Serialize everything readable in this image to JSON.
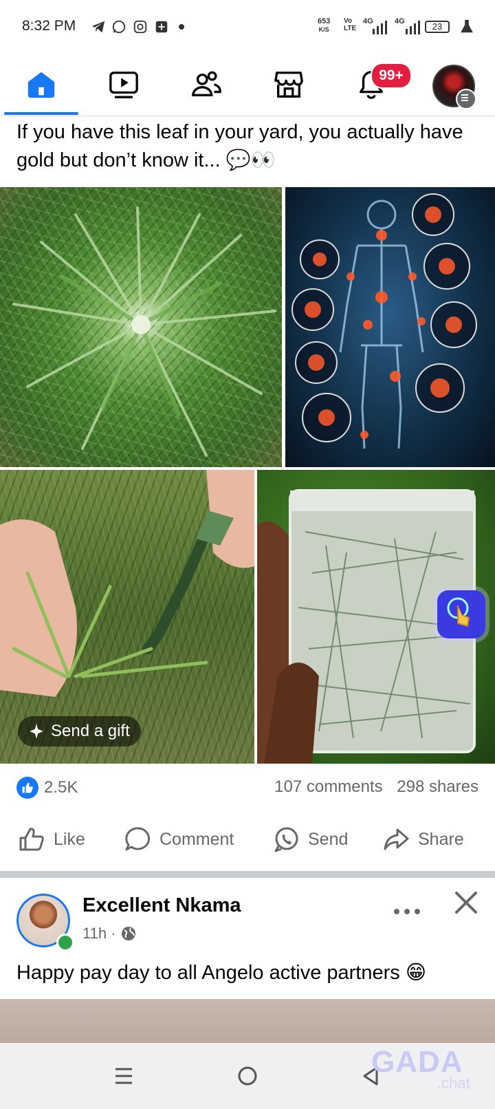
{
  "status_bar": {
    "time": "8:32 PM",
    "speed_value": "653",
    "speed_unit": "K/S",
    "net_label_1": "Vo LTE",
    "net_label_2": "4G",
    "net_label_3": "4G",
    "battery": "23",
    "icons": [
      "telegram-icon",
      "whatsapp-icon",
      "instagram-icon",
      "app-icon",
      "dot-icon",
      "signal-icon",
      "battery-icon",
      "lab-flask-icon"
    ]
  },
  "nav": {
    "tabs": [
      "home-tab",
      "video-tab",
      "friends-tab",
      "marketplace-tab",
      "notifications-tab",
      "menu-tab"
    ],
    "notifications_badge": "99+",
    "accent": "#1877f2"
  },
  "post1": {
    "text": "If you have this leaf in your yard, you actually have gold but don’t know it... 💬👀",
    "gift_label": "Send a gift",
    "likes": "2.5K",
    "comments": "107 comments",
    "shares": "298 shares",
    "actions": {
      "like": "Like",
      "comment": "Comment",
      "send": "Send",
      "share": "Share"
    }
  },
  "post2": {
    "author": "Excellent Nkama",
    "time": "11h ·",
    "text": "Happy pay day to all Angelo active partners 😁"
  },
  "watermark": {
    "brand": "GADA",
    "sub": ".chat"
  }
}
